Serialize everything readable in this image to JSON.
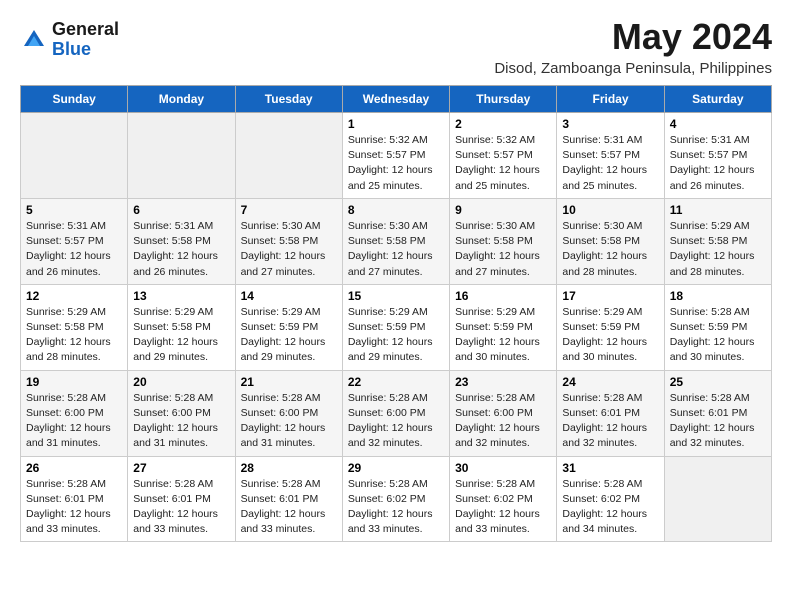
{
  "logo": {
    "general": "General",
    "blue": "Blue"
  },
  "title": "May 2024",
  "location": "Disod, Zamboanga Peninsula, Philippines",
  "days_header": [
    "Sunday",
    "Monday",
    "Tuesday",
    "Wednesday",
    "Thursday",
    "Friday",
    "Saturday"
  ],
  "weeks": [
    [
      {
        "day": "",
        "info": ""
      },
      {
        "day": "",
        "info": ""
      },
      {
        "day": "",
        "info": ""
      },
      {
        "day": "1",
        "info": "Sunrise: 5:32 AM\nSunset: 5:57 PM\nDaylight: 12 hours\nand 25 minutes."
      },
      {
        "day": "2",
        "info": "Sunrise: 5:32 AM\nSunset: 5:57 PM\nDaylight: 12 hours\nand 25 minutes."
      },
      {
        "day": "3",
        "info": "Sunrise: 5:31 AM\nSunset: 5:57 PM\nDaylight: 12 hours\nand 25 minutes."
      },
      {
        "day": "4",
        "info": "Sunrise: 5:31 AM\nSunset: 5:57 PM\nDaylight: 12 hours\nand 26 minutes."
      }
    ],
    [
      {
        "day": "5",
        "info": "Sunrise: 5:31 AM\nSunset: 5:57 PM\nDaylight: 12 hours\nand 26 minutes."
      },
      {
        "day": "6",
        "info": "Sunrise: 5:31 AM\nSunset: 5:58 PM\nDaylight: 12 hours\nand 26 minutes."
      },
      {
        "day": "7",
        "info": "Sunrise: 5:30 AM\nSunset: 5:58 PM\nDaylight: 12 hours\nand 27 minutes."
      },
      {
        "day": "8",
        "info": "Sunrise: 5:30 AM\nSunset: 5:58 PM\nDaylight: 12 hours\nand 27 minutes."
      },
      {
        "day": "9",
        "info": "Sunrise: 5:30 AM\nSunset: 5:58 PM\nDaylight: 12 hours\nand 27 minutes."
      },
      {
        "day": "10",
        "info": "Sunrise: 5:30 AM\nSunset: 5:58 PM\nDaylight: 12 hours\nand 28 minutes."
      },
      {
        "day": "11",
        "info": "Sunrise: 5:29 AM\nSunset: 5:58 PM\nDaylight: 12 hours\nand 28 minutes."
      }
    ],
    [
      {
        "day": "12",
        "info": "Sunrise: 5:29 AM\nSunset: 5:58 PM\nDaylight: 12 hours\nand 28 minutes."
      },
      {
        "day": "13",
        "info": "Sunrise: 5:29 AM\nSunset: 5:58 PM\nDaylight: 12 hours\nand 29 minutes."
      },
      {
        "day": "14",
        "info": "Sunrise: 5:29 AM\nSunset: 5:59 PM\nDaylight: 12 hours\nand 29 minutes."
      },
      {
        "day": "15",
        "info": "Sunrise: 5:29 AM\nSunset: 5:59 PM\nDaylight: 12 hours\nand 29 minutes."
      },
      {
        "day": "16",
        "info": "Sunrise: 5:29 AM\nSunset: 5:59 PM\nDaylight: 12 hours\nand 30 minutes."
      },
      {
        "day": "17",
        "info": "Sunrise: 5:29 AM\nSunset: 5:59 PM\nDaylight: 12 hours\nand 30 minutes."
      },
      {
        "day": "18",
        "info": "Sunrise: 5:28 AM\nSunset: 5:59 PM\nDaylight: 12 hours\nand 30 minutes."
      }
    ],
    [
      {
        "day": "19",
        "info": "Sunrise: 5:28 AM\nSunset: 6:00 PM\nDaylight: 12 hours\nand 31 minutes."
      },
      {
        "day": "20",
        "info": "Sunrise: 5:28 AM\nSunset: 6:00 PM\nDaylight: 12 hours\nand 31 minutes."
      },
      {
        "day": "21",
        "info": "Sunrise: 5:28 AM\nSunset: 6:00 PM\nDaylight: 12 hours\nand 31 minutes."
      },
      {
        "day": "22",
        "info": "Sunrise: 5:28 AM\nSunset: 6:00 PM\nDaylight: 12 hours\nand 32 minutes."
      },
      {
        "day": "23",
        "info": "Sunrise: 5:28 AM\nSunset: 6:00 PM\nDaylight: 12 hours\nand 32 minutes."
      },
      {
        "day": "24",
        "info": "Sunrise: 5:28 AM\nSunset: 6:01 PM\nDaylight: 12 hours\nand 32 minutes."
      },
      {
        "day": "25",
        "info": "Sunrise: 5:28 AM\nSunset: 6:01 PM\nDaylight: 12 hours\nand 32 minutes."
      }
    ],
    [
      {
        "day": "26",
        "info": "Sunrise: 5:28 AM\nSunset: 6:01 PM\nDaylight: 12 hours\nand 33 minutes."
      },
      {
        "day": "27",
        "info": "Sunrise: 5:28 AM\nSunset: 6:01 PM\nDaylight: 12 hours\nand 33 minutes."
      },
      {
        "day": "28",
        "info": "Sunrise: 5:28 AM\nSunset: 6:01 PM\nDaylight: 12 hours\nand 33 minutes."
      },
      {
        "day": "29",
        "info": "Sunrise: 5:28 AM\nSunset: 6:02 PM\nDaylight: 12 hours\nand 33 minutes."
      },
      {
        "day": "30",
        "info": "Sunrise: 5:28 AM\nSunset: 6:02 PM\nDaylight: 12 hours\nand 33 minutes."
      },
      {
        "day": "31",
        "info": "Sunrise: 5:28 AM\nSunset: 6:02 PM\nDaylight: 12 hours\nand 34 minutes."
      },
      {
        "day": "",
        "info": ""
      }
    ]
  ]
}
